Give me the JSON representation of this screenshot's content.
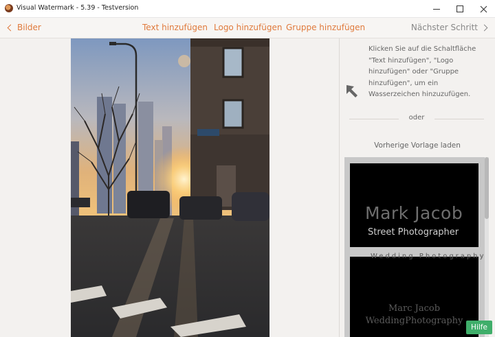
{
  "window": {
    "title": "Visual Watermark - 5.39 - Testversion"
  },
  "toolbar": {
    "back_label": "Bilder",
    "add_text": "Text hinzufügen",
    "add_logo": "Logo hinzufügen",
    "add_group": "Gruppe hinzufügen",
    "next_label": "Nächster Schritt"
  },
  "side_panel": {
    "hint": "Klicken Sie auf die Schaltfläche \"Text hinzufügen\", \"Logo hinzufügen\" oder \"Gruppe hinzufügen\", um ein Wasserzeichen hinzuzufügen.",
    "or_label": "oder",
    "load_template_label": "Vorherige Vorlage laden",
    "templates": [
      {
        "name": "Mark Jacob",
        "subtitle": "Street Photographer"
      },
      {
        "top_text": "Wedding Photography",
        "name": "Marc Jacob",
        "subtitle": "WeddingPhotography"
      }
    ]
  },
  "help_label": "Hilfe",
  "colors": {
    "accent": "#e07a3c",
    "help_green": "#3fae6a"
  }
}
